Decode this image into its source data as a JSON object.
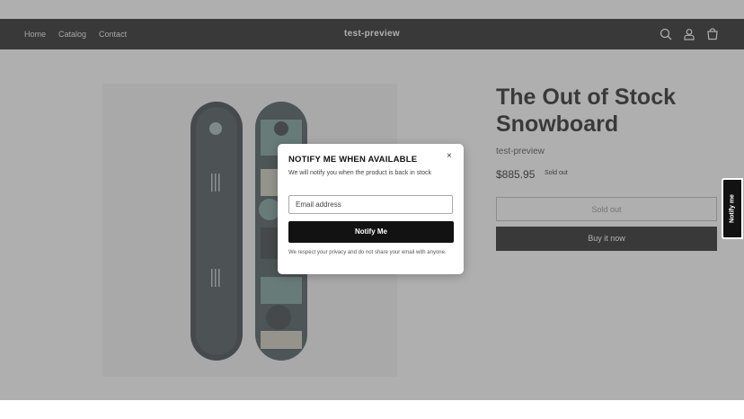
{
  "nav": {
    "items": [
      "Home",
      "Catalog",
      "Contact"
    ]
  },
  "brand": "test-preview",
  "header_icons": [
    "search-icon",
    "account-icon",
    "cart-icon"
  ],
  "product": {
    "title": "The Out of Stock Snowboard",
    "vendor": "test-preview",
    "price": "$885.95",
    "badge": "Sold out",
    "sold_out_button": "Sold out",
    "buy_button": "Buy it now"
  },
  "notify_tab": "Notify me",
  "modal": {
    "title": "NOTIFY ME WHEN AVAILABLE",
    "close": "×",
    "description": "We will notify you when the product is back in stock",
    "email_placeholder": "Email address",
    "submit": "Notify Me",
    "privacy": "We respect your privacy and do not share your email with anyone."
  },
  "colors": {
    "header_bg": "#121212",
    "button_dark": "#121212",
    "overlay": "rgba(95,95,95,0.5)"
  }
}
